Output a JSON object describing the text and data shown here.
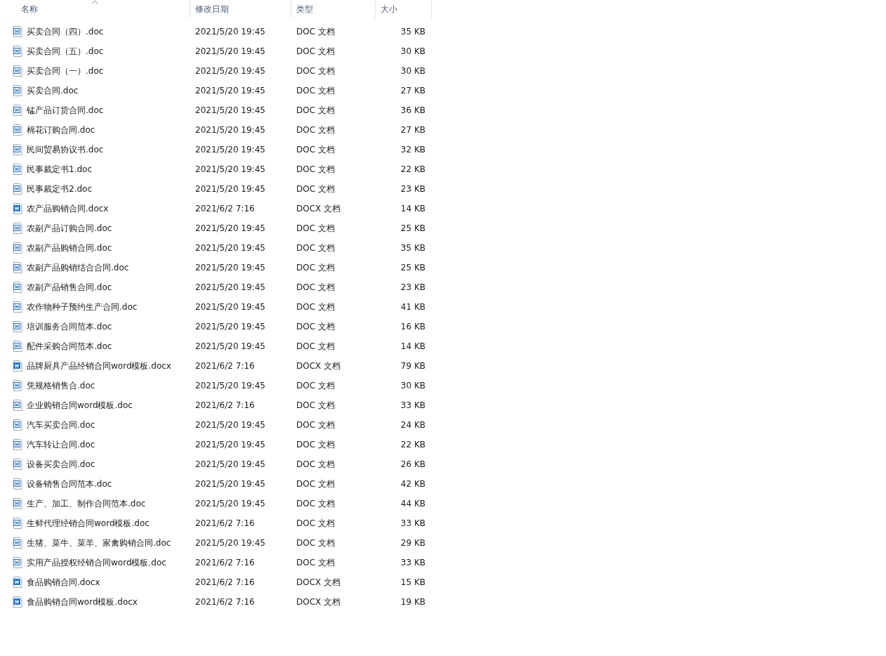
{
  "columns": [
    {
      "label": "名称",
      "sorted": true
    },
    {
      "label": "修改日期",
      "sorted": false
    },
    {
      "label": "类型",
      "sorted": false
    },
    {
      "label": "大小",
      "sorted": false
    }
  ],
  "rows": [
    {
      "name": "买卖合同（四）.doc",
      "kind": "doc",
      "modified": "2021/5/20 19:45",
      "type": "DOC 文档",
      "size": "35 KB"
    },
    {
      "name": "买卖合同（五）.doc",
      "kind": "doc",
      "modified": "2021/5/20 19:45",
      "type": "DOC 文档",
      "size": "30 KB"
    },
    {
      "name": "买卖合同（一）.doc",
      "kind": "doc",
      "modified": "2021/5/20 19:45",
      "type": "DOC 文档",
      "size": "30 KB"
    },
    {
      "name": "买卖合同.doc",
      "kind": "doc",
      "modified": "2021/5/20 19:45",
      "type": "DOC 文档",
      "size": "27 KB"
    },
    {
      "name": "锰产品订货合同.doc",
      "kind": "doc",
      "modified": "2021/5/20 19:45",
      "type": "DOC 文档",
      "size": "36 KB"
    },
    {
      "name": "棉花订购合同.doc",
      "kind": "doc",
      "modified": "2021/5/20 19:45",
      "type": "DOC 文档",
      "size": "27 KB"
    },
    {
      "name": "民间贸易协议书.doc",
      "kind": "doc",
      "modified": "2021/5/20 19:45",
      "type": "DOC 文档",
      "size": "32 KB"
    },
    {
      "name": "民事裁定书1.doc",
      "kind": "doc",
      "modified": "2021/5/20 19:45",
      "type": "DOC 文档",
      "size": "22 KB"
    },
    {
      "name": "民事裁定书2.doc",
      "kind": "doc",
      "modified": "2021/5/20 19:45",
      "type": "DOC 文档",
      "size": "23 KB"
    },
    {
      "name": "农产品购销合同.docx",
      "kind": "docx",
      "modified": "2021/6/2 7:16",
      "type": "DOCX 文档",
      "size": "14 KB"
    },
    {
      "name": "农副产品订购合同.doc",
      "kind": "doc",
      "modified": "2021/5/20 19:45",
      "type": "DOC 文档",
      "size": "25 KB"
    },
    {
      "name": "农副产品购销合同.doc",
      "kind": "doc",
      "modified": "2021/5/20 19:45",
      "type": "DOC 文档",
      "size": "35 KB"
    },
    {
      "name": "农副产品购销结合合同.doc",
      "kind": "doc",
      "modified": "2021/5/20 19:45",
      "type": "DOC 文档",
      "size": "25 KB"
    },
    {
      "name": "农副产品销售合同.doc",
      "kind": "doc",
      "modified": "2021/5/20 19:45",
      "type": "DOC 文档",
      "size": "23 KB"
    },
    {
      "name": "农作物种子预约生产合同.doc",
      "kind": "doc",
      "modified": "2021/5/20 19:45",
      "type": "DOC 文档",
      "size": "41 KB"
    },
    {
      "name": "培训服务合同范本.doc",
      "kind": "doc",
      "modified": "2021/5/20 19:45",
      "type": "DOC 文档",
      "size": "16 KB"
    },
    {
      "name": "配件采购合同范本.doc",
      "kind": "doc",
      "modified": "2021/5/20 19:45",
      "type": "DOC 文档",
      "size": "14 KB"
    },
    {
      "name": "品牌厨具产品经销合同word模板.docx",
      "kind": "docx",
      "modified": "2021/6/2 7:16",
      "type": "DOCX 文档",
      "size": "79 KB"
    },
    {
      "name": "凭规格销售合.doc",
      "kind": "doc",
      "modified": "2021/5/20 19:45",
      "type": "DOC 文档",
      "size": "30 KB"
    },
    {
      "name": "企业购销合同word模板.doc",
      "kind": "doc",
      "modified": "2021/6/2 7:16",
      "type": "DOC 文档",
      "size": "33 KB"
    },
    {
      "name": "汽车买卖合同.doc",
      "kind": "doc",
      "modified": "2021/5/20 19:45",
      "type": "DOC 文档",
      "size": "24 KB"
    },
    {
      "name": "汽车转让合同.doc",
      "kind": "doc",
      "modified": "2021/5/20 19:45",
      "type": "DOC 文档",
      "size": "22 KB"
    },
    {
      "name": "设备买卖合同.doc",
      "kind": "doc",
      "modified": "2021/5/20 19:45",
      "type": "DOC 文档",
      "size": "26 KB"
    },
    {
      "name": "设备销售合同范本.doc",
      "kind": "doc",
      "modified": "2021/5/20 19:45",
      "type": "DOC 文档",
      "size": "42 KB"
    },
    {
      "name": "生产、加工、制作合同范本.doc",
      "kind": "doc",
      "modified": "2021/5/20 19:45",
      "type": "DOC 文档",
      "size": "44 KB"
    },
    {
      "name": "生鲜代理经销合同word模板.doc",
      "kind": "doc",
      "modified": "2021/6/2 7:16",
      "type": "DOC 文档",
      "size": "33 KB"
    },
    {
      "name": "生猪、菜牛、菜羊、家禽购销合同.doc",
      "kind": "doc",
      "modified": "2021/5/20 19:45",
      "type": "DOC 文档",
      "size": "29 KB"
    },
    {
      "name": "实用产品授权经销合同word模板.doc",
      "kind": "doc",
      "modified": "2021/6/2 7:16",
      "type": "DOC 文档",
      "size": "33 KB"
    },
    {
      "name": "食品购销合同.docx",
      "kind": "docx",
      "modified": "2021/6/2 7:16",
      "type": "DOCX 文档",
      "size": "15 KB"
    },
    {
      "name": "食品购销合同word模板.docx",
      "kind": "docx",
      "modified": "2021/6/2 7:16",
      "type": "DOCX 文档",
      "size": "19 KB"
    }
  ]
}
